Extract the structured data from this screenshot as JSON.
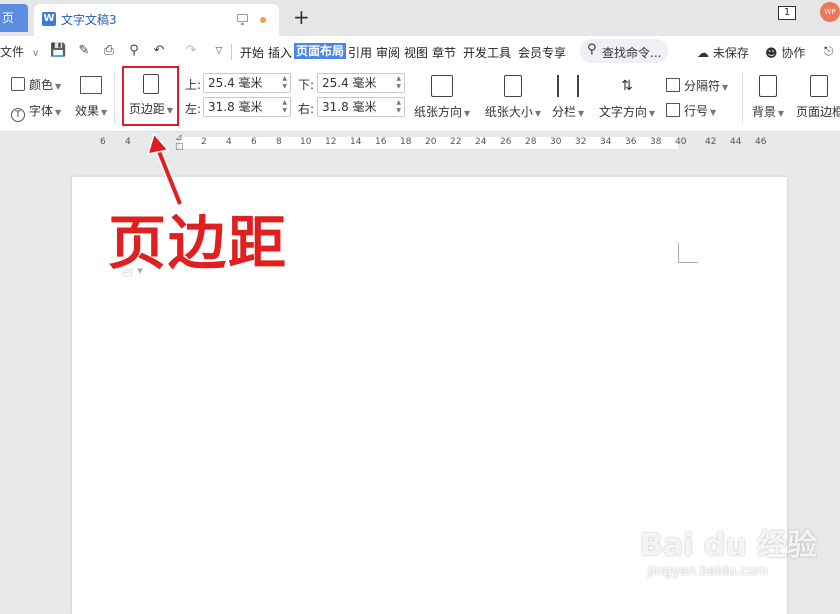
{
  "tabs": {
    "home_label": "页",
    "doc_title": "文字文稿3",
    "page_count": "1",
    "avatar": "WP"
  },
  "menu": {
    "file": "文件",
    "items": [
      "开始",
      "插入",
      "页面布局",
      "引用",
      "审阅",
      "视图",
      "章节",
      "开发工具",
      "会员专享"
    ],
    "active_index": 2,
    "search": "查找命令...",
    "unsaved": "未保存",
    "collab": "协作"
  },
  "ribbon": {
    "color": "颜色",
    "font": "字体",
    "effect": "效果",
    "margins": "页边距",
    "margin_fields": {
      "top_label": "上:",
      "top_value": "25.4 毫米",
      "bottom_label": "下:",
      "bottom_value": "25.4 毫米",
      "left_label": "左:",
      "left_value": "31.8 毫米",
      "right_label": "右:",
      "right_value": "31.8 毫米"
    },
    "orientation": "纸张方向",
    "size": "纸张大小",
    "columns": "分栏",
    "text_direction": "文字方向",
    "separator": "分隔符",
    "line_number": "行号",
    "background": "背景",
    "page_border": "页面边框"
  },
  "ruler_ticks": [
    "6",
    "4",
    "2",
    "2",
    "4",
    "6",
    "8",
    "10",
    "12",
    "14",
    "16",
    "18",
    "20",
    "22",
    "24",
    "26",
    "28",
    "30",
    "32",
    "34",
    "36",
    "38",
    "40",
    "42",
    "44",
    "46"
  ],
  "annotation": {
    "text": "页边距",
    "color": "#e02020"
  },
  "watermark": {
    "main": "Bai du 经验",
    "sub": "jingyan.baidu.com"
  },
  "colors": {
    "accent": "#4a86e8",
    "highlight": "#e02020"
  }
}
